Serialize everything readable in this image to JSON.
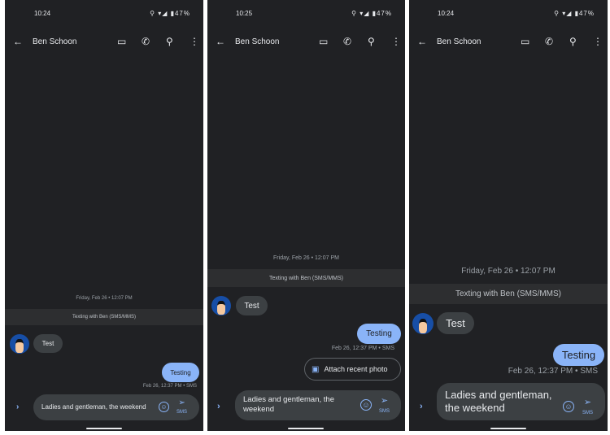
{
  "panels": [
    {
      "time": "10:24",
      "battery": "47%",
      "contact": "Ben Schoon",
      "date": "Friday, Feb 26 • 12:07 PM",
      "banner": "Texting with Ben (SMS/MMS)",
      "incoming": "Test",
      "outgoing": "Testing",
      "timestamp": "Feb 26, 12:37 PM • SMS",
      "compose": "Ladies and gentleman, the weekend",
      "send_label": "SMS"
    },
    {
      "time": "10:25",
      "battery": "47%",
      "contact": "Ben Schoon",
      "date": "Friday, Feb 26 • 12:07 PM",
      "banner": "Texting with Ben (SMS/MMS)",
      "incoming": "Test",
      "outgoing": "Testing",
      "timestamp": "Feb 26, 12:37 PM • SMS",
      "attach": "Attach recent photo",
      "compose": "Ladies and gentleman, the weekend",
      "send_label": "SMS"
    },
    {
      "time": "10:24",
      "battery": "47%",
      "contact": "Ben Schoon",
      "date": "Friday, Feb 26 • 12:07 PM",
      "banner": "Texting with Ben (SMS/MMS)",
      "incoming": "Test",
      "outgoing": "Testing",
      "timestamp": "Feb 26, 12:37 PM • SMS",
      "compose": "Ladies and gentleman, the weekend",
      "send_label": "SMS"
    }
  ],
  "icons": [
    "arrow-back-icon",
    "video-call-icon",
    "phone-icon",
    "search-icon",
    "more-vert-icon",
    "emoji-icon",
    "send-icon",
    "expand-icon",
    "image-icon"
  ],
  "colors": {
    "background": "#202124",
    "outgoing_bubble": "#8ab4f8",
    "incoming_bubble": "#3c4043",
    "accent": "#8ab4f8"
  }
}
